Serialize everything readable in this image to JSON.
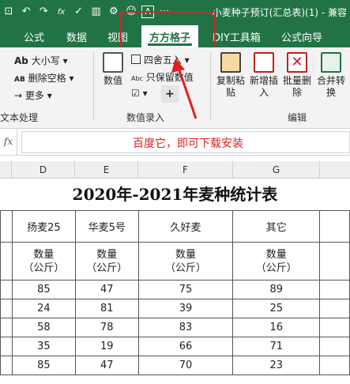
{
  "window": {
    "title": "小麦种子预订(汇总表)(1) - 兼容"
  },
  "qat": [
    {
      "icon": "save-icon",
      "glyph": "⊡"
    },
    {
      "icon": "undo-icon",
      "glyph": "↶"
    },
    {
      "icon": "redo-icon",
      "glyph": "↷"
    },
    {
      "icon": "function-icon",
      "glyph": "fx"
    },
    {
      "icon": "check-icon",
      "glyph": "✓"
    },
    {
      "icon": "chart-icon",
      "glyph": "▥"
    },
    {
      "icon": "gear-icon",
      "glyph": "⚙"
    },
    {
      "icon": "emoji-icon",
      "glyph": "☺"
    },
    {
      "icon": "text-icon",
      "glyph": "A"
    },
    {
      "icon": "more-icon",
      "glyph": "⋯"
    }
  ],
  "tabs": [
    {
      "label": "公式"
    },
    {
      "label": "数据"
    },
    {
      "label": "视图"
    },
    {
      "label": "方方格子"
    },
    {
      "label": "DIY工具箱"
    },
    {
      "label": "公式向导"
    }
  ],
  "ribbon": {
    "text_tools": {
      "size_label": "大小写",
      "delete_space_label": "删除空格",
      "more_label": "更多",
      "group_label": "文本处理"
    },
    "number": {
      "numeric_label": "数值",
      "round_label": "四舍五入",
      "keep_label": "只保留数值",
      "plus_label": "+",
      "group_label": "数值录入"
    },
    "edit": {
      "copy_paste_label": "复制粘\n贴",
      "insert_label": "新增插\n入",
      "batch_delete_label": "批量删\n除",
      "merge_label": "合并转\n换",
      "group_label": "编辑"
    }
  },
  "formula": {
    "fx_label": "fx",
    "content": "百度它，即可下载安装"
  },
  "columns": [
    "D",
    "E",
    "F",
    "G"
  ],
  "sheet": {
    "title": "2020年-2021年麦种统计表",
    "varieties": [
      "扬麦25",
      "华麦5号",
      "久好麦",
      "其它"
    ],
    "unit_label": "数量\n（公斤）",
    "rows": [
      [
        "85",
        "47",
        "75",
        "89"
      ],
      [
        "24",
        "81",
        "39",
        "25"
      ],
      [
        "58",
        "78",
        "83",
        "16"
      ],
      [
        "35",
        "19",
        "66",
        "71"
      ],
      [
        "85",
        "47",
        "70",
        "23"
      ]
    ]
  },
  "colors": {
    "excel_green": "#217346",
    "highlight_red": "#e02020"
  }
}
